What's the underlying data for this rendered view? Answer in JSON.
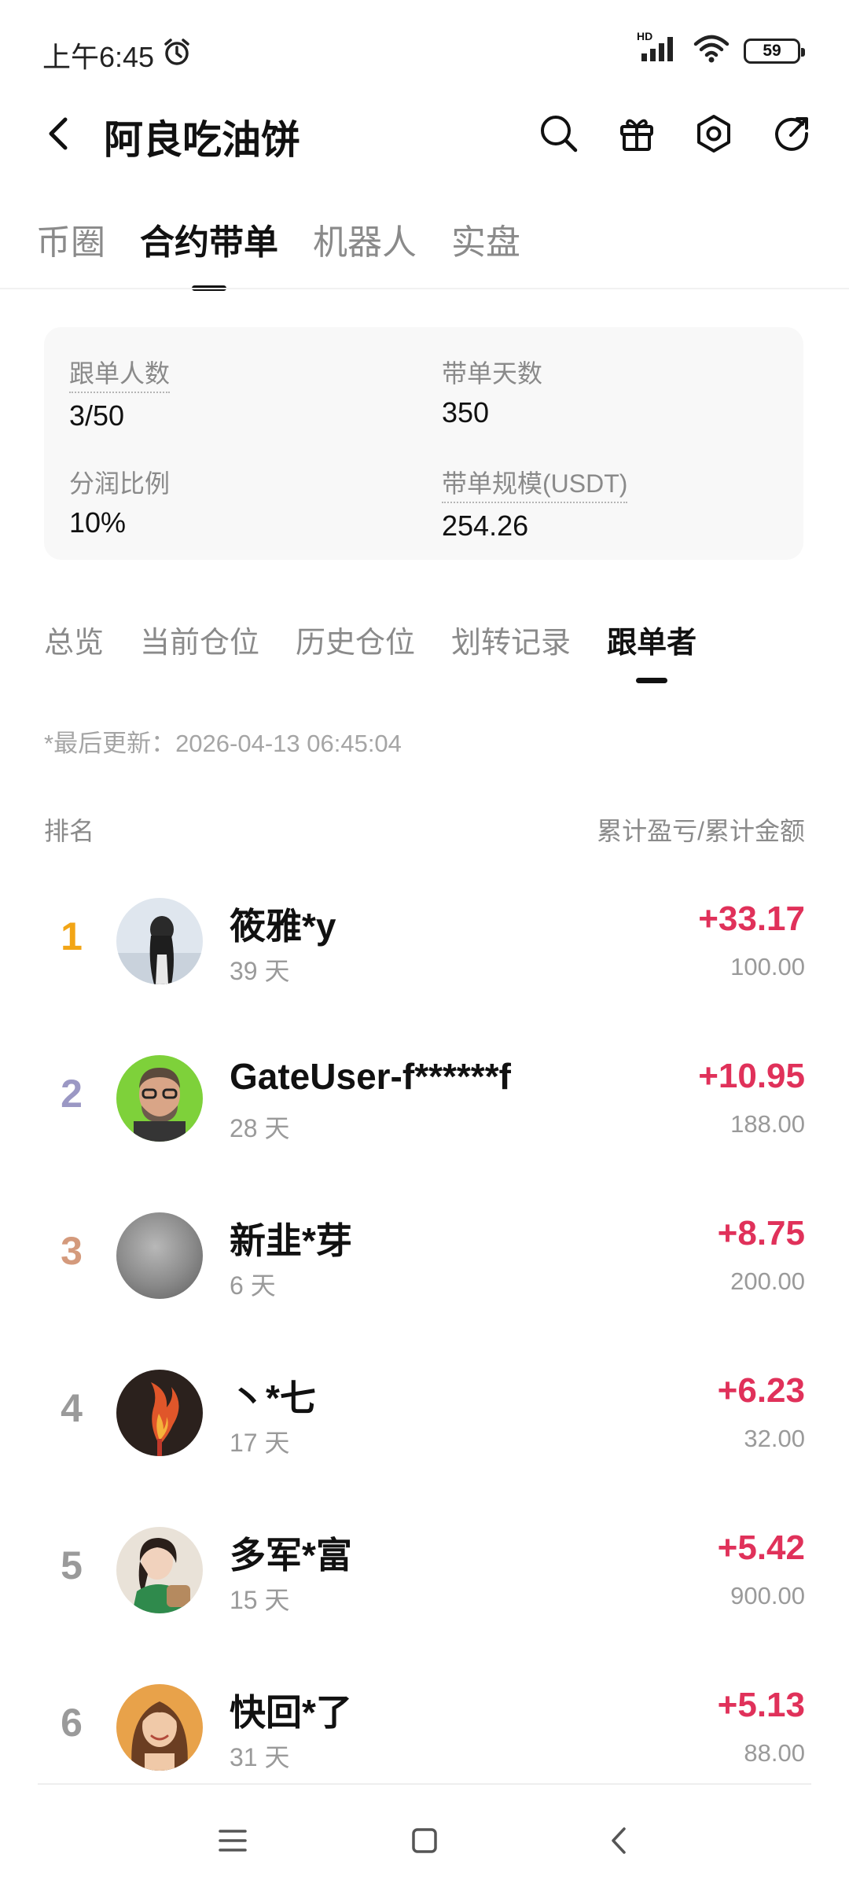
{
  "status_bar": {
    "time": "上午6:45",
    "network_label": "HD",
    "battery": "59"
  },
  "header": {
    "title": "阿良吃油饼"
  },
  "main_tabs": [
    {
      "label": "币圈",
      "active": false
    },
    {
      "label": "合约带单",
      "active": true
    },
    {
      "label": "机器人",
      "active": false
    },
    {
      "label": "实盘",
      "active": false
    }
  ],
  "stats": {
    "followers_label": "跟单人数",
    "followers_value": "3/50",
    "days_label": "带单天数",
    "days_value": "350",
    "profit_share_label": "分润比例",
    "profit_share_value": "10%",
    "scale_label": "带单规模(USDT)",
    "scale_value": "254.26"
  },
  "sub_tabs": [
    {
      "label": "总览",
      "active": false
    },
    {
      "label": "当前仓位",
      "active": false
    },
    {
      "label": "历史仓位",
      "active": false
    },
    {
      "label": "划转记录",
      "active": false
    },
    {
      "label": "跟单者",
      "active": true
    }
  ],
  "last_updated": "*最后更新：2026-04-13 06:45:04",
  "list_header": {
    "left": "排名",
    "right": "累计盈亏/累计金额"
  },
  "followers": [
    {
      "rank": "1",
      "name": "筱雅*y",
      "days": "39 天",
      "pnl": "+33.17",
      "amount": "100.00",
      "rank_color": "#f2a516"
    },
    {
      "rank": "2",
      "name": "GateUser-f******f",
      "days": "28 天",
      "pnl": "+10.95",
      "amount": "188.00",
      "rank_color": "#9b98c4"
    },
    {
      "rank": "3",
      "name": "新韭*芽",
      "days": "6 天",
      "pnl": "+8.75",
      "amount": "200.00",
      "rank_color": "#d49a7c"
    },
    {
      "rank": "4",
      "name": "丶*七",
      "days": "17 天",
      "pnl": "+6.23",
      "amount": "32.00",
      "rank_color": "#9a9a9a"
    },
    {
      "rank": "5",
      "name": "多军*富",
      "days": "15 天",
      "pnl": "+5.42",
      "amount": "900.00",
      "rank_color": "#9a9a9a"
    },
    {
      "rank": "6",
      "name": "快回*了",
      "days": "31 天",
      "pnl": "+5.13",
      "amount": "88.00",
      "rank_color": "#9a9a9a"
    }
  ],
  "colors": {
    "profit": "#e0315a",
    "active_text": "#111111",
    "inactive_text": "#8a8a8a"
  }
}
